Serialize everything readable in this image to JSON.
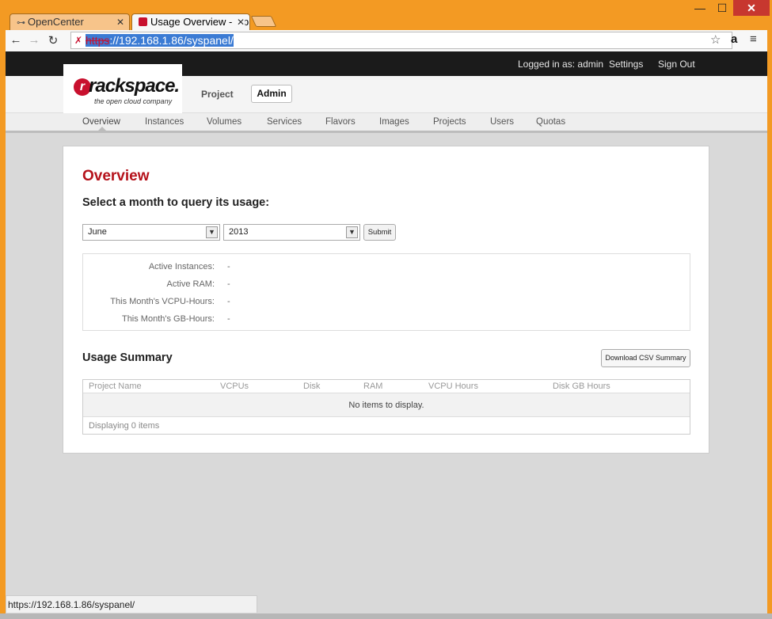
{
  "tabs": [
    {
      "label": "OpenCenter",
      "active": false
    },
    {
      "label": "Usage Overview - Op",
      "active": true
    }
  ],
  "window_controls": {
    "minimize": "—",
    "maximize": "☐",
    "close": "✕"
  },
  "address_bar": {
    "scheme": "https",
    "host": "://192.168.1.86",
    "path": "/syspanel/"
  },
  "topbar": {
    "logged_in": "Logged in as: admin",
    "settings": "Settings",
    "sign_out": "Sign Out"
  },
  "brand": {
    "name": "rackspace.",
    "tagline": "the open cloud company"
  },
  "dashboards": {
    "project": "Project",
    "admin": "Admin"
  },
  "subnav": [
    "Overview",
    "Instances",
    "Volumes",
    "Services",
    "Flavors",
    "Images",
    "Projects",
    "Users",
    "Quotas"
  ],
  "main": {
    "title": "Overview",
    "select_heading": "Select a month to query its usage:",
    "month": "June",
    "year": "2013",
    "submit": "Submit"
  },
  "stats": [
    {
      "label": "Active Instances:",
      "value": "-"
    },
    {
      "label": "Active RAM:",
      "value": "-"
    },
    {
      "label": "This Month's VCPU-Hours:",
      "value": "-"
    },
    {
      "label": "This Month's GB-Hours:",
      "value": "-"
    }
  ],
  "usage": {
    "title": "Usage Summary",
    "download": "Download CSV Summary",
    "columns": [
      "Project Name",
      "VCPUs",
      "Disk",
      "RAM",
      "VCPU Hours",
      "Disk GB Hours"
    ],
    "empty": "No items to display.",
    "footer": "Displaying 0 items"
  },
  "statusbar": "https://192.168.1.86/syspanel/",
  "colors": {
    "accent": "#b5121b",
    "frame": "#f39a23",
    "topbar": "#1b1b1b"
  }
}
